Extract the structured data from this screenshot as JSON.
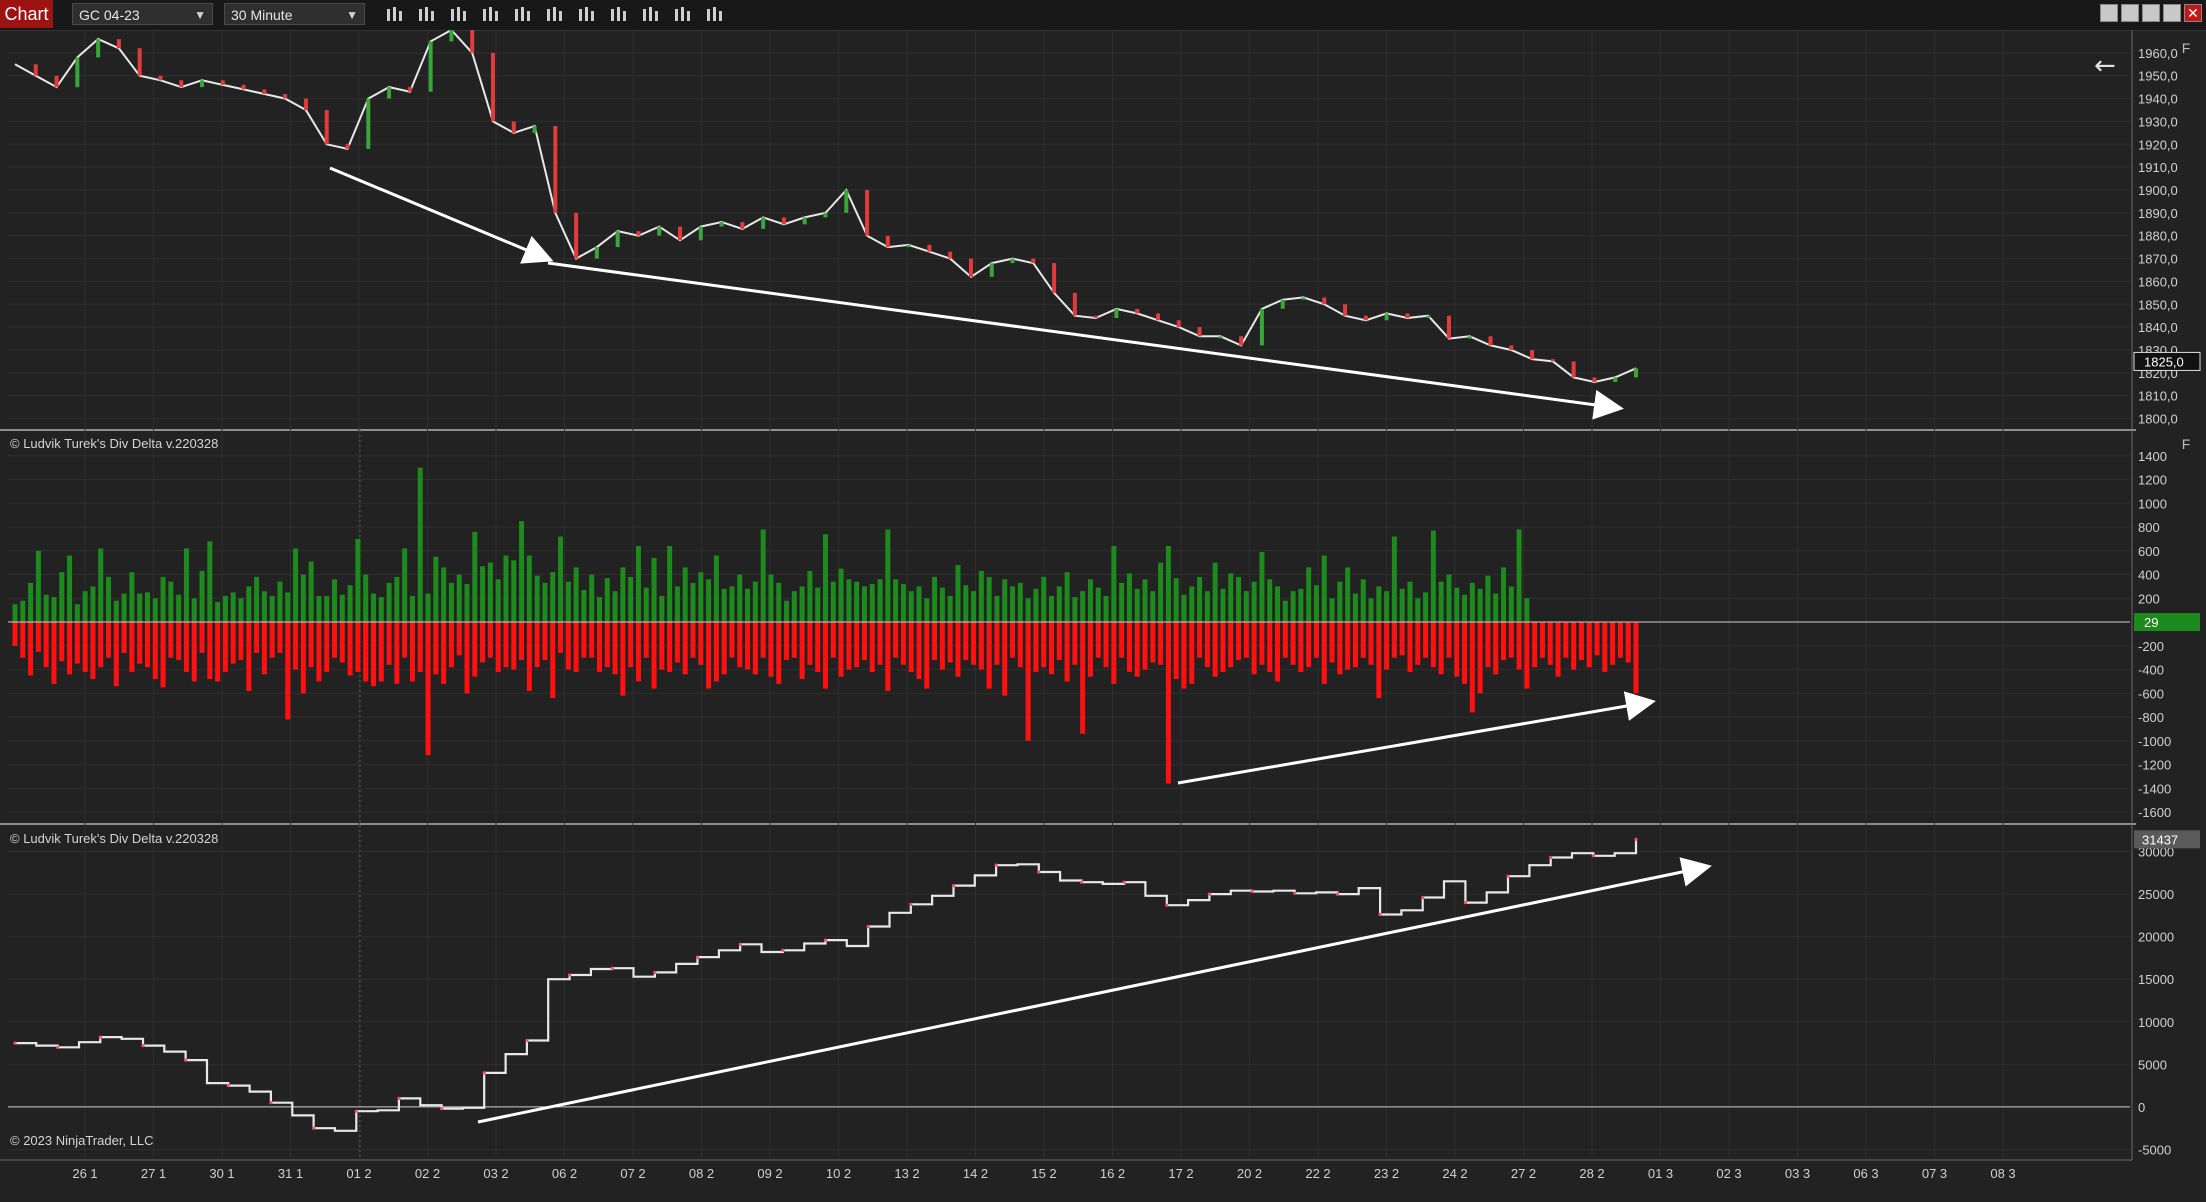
{
  "toolbar": {
    "app_title": "Chart",
    "instrument": "GC 04-23",
    "timeframe": "30 Minute",
    "tools": [
      "bars-icon",
      "pencil-icon",
      "zoom-in-icon",
      "zoom-out-icon",
      "crosshair-icon",
      "data-box-icon",
      "drawing-tools-icon",
      "strategies-icon",
      "indicators-icon",
      "properties-icon",
      "list-icon"
    ]
  },
  "panels": {
    "price": {
      "yticks": [
        "1960,0",
        "1950,0",
        "1940,0",
        "1930,0",
        "1920,0",
        "1910,0",
        "1900,0",
        "1890,0",
        "1880,0",
        "1870,0",
        "1860,0",
        "1850,0",
        "1840,0",
        "1830,0",
        "1820,0",
        "1810,0",
        "1800,0"
      ],
      "last_price": "1825,0"
    },
    "delta": {
      "label": "© Ludvik Turek's Div Delta v.220328",
      "yticks": [
        "1400",
        "1200",
        "1000",
        "800",
        "600",
        "400",
        "200",
        "-200",
        "-400",
        "-600",
        "-800",
        "-1000",
        "-1200",
        "-1400",
        "-1600"
      ],
      "last_value": "29"
    },
    "cumulative": {
      "label": "© Ludvik Turek's Div Delta v.220328",
      "yticks": [
        "30000",
        "25000",
        "20000",
        "15000",
        "10000",
        "5000",
        "0",
        "-5000"
      ],
      "last_value": "31437"
    }
  },
  "xaxis": {
    "labels": [
      "26 1",
      "27 1",
      "30 1",
      "31 1",
      "01 2",
      "02 2",
      "03 2",
      "06 2",
      "07 2",
      "08 2",
      "09 2",
      "10 2",
      "13 2",
      "14 2",
      "15 2",
      "16 2",
      "17 2",
      "20 2",
      "22 2",
      "23 2",
      "24 2",
      "27 2",
      "28 2",
      "01 3",
      "02 3",
      "03 3",
      "06 3",
      "07 3",
      "08 3"
    ]
  },
  "footer": {
    "copyright": "© 2023 NinjaTrader, LLC"
  },
  "colors": {
    "up": "#1c8a1c",
    "down": "#ff1010",
    "bg": "#222222",
    "grid": "#2e2e2e",
    "accent": "#9d1212",
    "arrow": "#ffffff"
  },
  "chart_data": [
    {
      "type": "line",
      "title": "",
      "xlabel": "",
      "ylabel": "",
      "ylim": [
        1795,
        1970
      ],
      "series": [
        {
          "values": [
            1955,
            1950,
            1945,
            1958,
            1966,
            1962,
            1950,
            1948,
            1945,
            1948,
            1946,
            1944,
            1942,
            1940,
            1935,
            1920,
            1918,
            1940,
            1945,
            1943,
            1965,
            1970,
            1960,
            1930,
            1925,
            1928,
            1890,
            1870,
            1875,
            1882,
            1880,
            1884,
            1878,
            1884,
            1886,
            1883,
            1888,
            1885,
            1888,
            1890,
            1900,
            1880,
            1875,
            1876,
            1873,
            1870,
            1862,
            1868,
            1870,
            1868,
            1855,
            1845,
            1844,
            1848,
            1846,
            1843,
            1840,
            1836,
            1836,
            1832,
            1848,
            1852,
            1853,
            1850,
            1845,
            1843,
            1846,
            1844,
            1845,
            1835,
            1836,
            1832,
            1830,
            1826,
            1825,
            1818,
            1816,
            1818,
            1822
          ]
        }
      ]
    },
    {
      "type": "bar",
      "title": "",
      "xlabel": "",
      "ylabel": "",
      "ylim": [
        -1700,
        1600
      ],
      "series": [
        {
          "values": [
            150,
            180,
            330,
            600,
            230,
            210,
            420,
            560,
            150,
            260,
            300,
            620,
            380,
            180,
            240,
            420,
            240,
            250,
            200,
            380,
            340,
            230,
            620,
            200,
            430,
            680,
            170,
            220,
            250,
            200,
            300,
            380,
            260,
            220,
            340,
            250,
            620,
            400,
            510,
            220,
            220,
            360,
            230,
            310,
            700,
            400,
            240,
            210,
            330,
            380,
            620,
            220,
            1300,
            240,
            550,
            460,
            330,
            400,
            320,
            760,
            470,
            500,
            360,
            560,
            520,
            850,
            560,
            390,
            330,
            420,
            720,
            340,
            460,
            270,
            400,
            210,
            370,
            260,
            460,
            380,
            640,
            290,
            540,
            220,
            640,
            300,
            460,
            330,
            420,
            360,
            560,
            280,
            300,
            400,
            280,
            340,
            780,
            400,
            330,
            180,
            260,
            300,
            430,
            290,
            740,
            340,
            450,
            360,
            340,
            300,
            320,
            360,
            780,
            360,
            320,
            260,
            300,
            200,
            380,
            290,
            220,
            480,
            310,
            260,
            430,
            380,
            220,
            360,
            300,
            330,
            200,
            280,
            380,
            220,
            300,
            420,
            210,
            260,
            360,
            290,
            220,
            640,
            330,
            410,
            280,
            360,
            260,
            500,
            640,
            370,
            230,
            300,
            380,
            260,
            500,
            280,
            410,
            380,
            260,
            340,
            590,
            360,
            300,
            180,
            260,
            280,
            460,
            310,
            560,
            200,
            340,
            460,
            240,
            360,
            200,
            300,
            260,
            720,
            280,
            340,
            200,
            250,
            770,
            340,
            400,
            290,
            230,
            330,
            280,
            390,
            240,
            460,
            300,
            780,
            200
          ]
        },
        {
          "values": [
            -200,
            -300,
            -450,
            -250,
            -380,
            -520,
            -330,
            -440,
            -350,
            -420,
            -480,
            -380,
            -300,
            -540,
            -260,
            -420,
            -350,
            -380,
            -480,
            -550,
            -300,
            -320,
            -420,
            -500,
            -260,
            -480,
            -500,
            -420,
            -350,
            -320,
            -580,
            -260,
            -440,
            -300,
            -260,
            -820,
            -400,
            -600,
            -380,
            -500,
            -420,
            -300,
            -340,
            -450,
            -420,
            -500,
            -540,
            -500,
            -360,
            -520,
            -300,
            -500,
            -420,
            -1120,
            -440,
            -520,
            -380,
            -280,
            -600,
            -460,
            -340,
            -300,
            -420,
            -380,
            -400,
            -320,
            -580,
            -380,
            -320,
            -640,
            -260,
            -400,
            -420,
            -300,
            -300,
            -420,
            -380,
            -440,
            -620,
            -380,
            -500,
            -300,
            -560,
            -400,
            -420,
            -340,
            -440,
            -300,
            -360,
            -560,
            -500,
            -440,
            -300,
            -380,
            -400,
            -440,
            -300,
            -460,
            -520,
            -320,
            -300,
            -480,
            -360,
            -420,
            -560,
            -300,
            -460,
            -400,
            -380,
            -320,
            -420,
            -360,
            -580,
            -300,
            -360,
            -420,
            -480,
            -560,
            -320,
            -400,
            -340,
            -460,
            -320,
            -360,
            -400,
            -560,
            -360,
            -620,
            -300,
            -380,
            -1000,
            -420,
            -380,
            -440,
            -320,
            -500,
            -360,
            -940,
            -460,
            -300,
            -380,
            -520,
            -300,
            -420,
            -460,
            -400,
            -340,
            -360,
            -1360,
            -480,
            -560,
            -520,
            -300,
            -380,
            -460,
            -420,
            -380,
            -320,
            -300,
            -440,
            -360,
            -420,
            -500,
            -300,
            -360,
            -420,
            -380,
            -300,
            -520,
            -340,
            -440,
            -400,
            -380,
            -300,
            -360,
            -640,
            -400,
            -300,
            -280,
            -420,
            -360,
            -300,
            -380,
            -440,
            -300,
            -460,
            -520,
            -760,
            -600,
            -380,
            -440,
            -320,
            -300,
            -400,
            -560,
            -380,
            -300,
            -360,
            -460,
            -300,
            -400,
            -320,
            -380,
            -280,
            -420,
            -360,
            -300,
            -340,
            -600
          ]
        }
      ]
    },
    {
      "type": "line",
      "title": "",
      "xlabel": "",
      "ylabel": "",
      "ylim": [
        -6000,
        33000
      ],
      "series": [
        {
          "values": [
            7500,
            7200,
            7000,
            7600,
            8200,
            8000,
            7200,
            6500,
            5500,
            2800,
            2500,
            1800,
            500,
            -1000,
            -2500,
            -2800,
            -500,
            -400,
            1000,
            200,
            -200,
            -100,
            4000,
            6200,
            7800,
            15000,
            15500,
            16200,
            16300,
            15300,
            15800,
            16800,
            17600,
            18400,
            19100,
            18200,
            18400,
            19200,
            19600,
            18900,
            21200,
            22800,
            23800,
            24800,
            26000,
            27200,
            28400,
            28500,
            27600,
            26600,
            26400,
            26200,
            26400,
            24800,
            23700,
            24300,
            25000,
            25400,
            25300,
            25400,
            25100,
            25200,
            25000,
            25700,
            22600,
            23100,
            24600,
            26500,
            24000,
            25200,
            27100,
            28400,
            29300,
            29800,
            29500,
            29800,
            31437
          ]
        }
      ]
    }
  ]
}
